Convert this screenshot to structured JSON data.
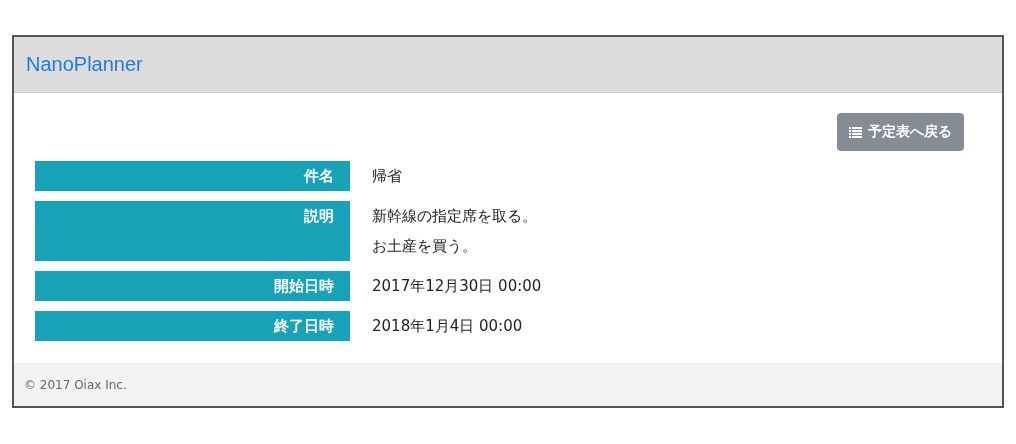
{
  "navbar": {
    "brand": "NanoPlanner"
  },
  "back_button": {
    "label": "予定表へ戻る"
  },
  "details": [
    {
      "label": "件名",
      "lines": [
        "帰省"
      ]
    },
    {
      "label": "説明",
      "lines": [
        "新幹線の指定席を取る。",
        "お土産を買う。"
      ]
    },
    {
      "label": "開始日時",
      "lines": [
        "2017年12月30日 00:00"
      ]
    },
    {
      "label": "終了日時",
      "lines": [
        "2018年1月4日 00:00"
      ]
    }
  ],
  "footer": "© 2017 Oiax Inc."
}
